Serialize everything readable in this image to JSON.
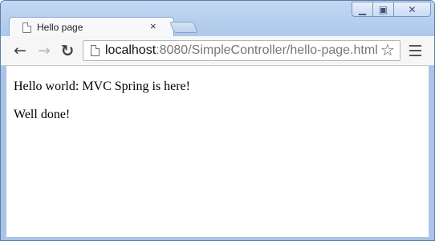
{
  "browser": {
    "tab": {
      "title": "Hello page",
      "close": "×"
    },
    "window_controls": {
      "minimize": "▁",
      "maximize": "▣",
      "close": "✕"
    },
    "nav": {
      "back": "←",
      "forward": "→",
      "reload": "↻"
    },
    "address": {
      "host": "localhost",
      "rest": ":8080/SimpleController/hello-page.html"
    },
    "bookmark_star": "☆",
    "icons": [
      "page-icon",
      "back-arrow-icon",
      "forward-arrow-icon",
      "reload-icon",
      "star-icon",
      "menu-icon"
    ]
  },
  "page": {
    "lines": [
      "Hello world: MVC Spring is here!",
      "Well done!"
    ]
  }
}
